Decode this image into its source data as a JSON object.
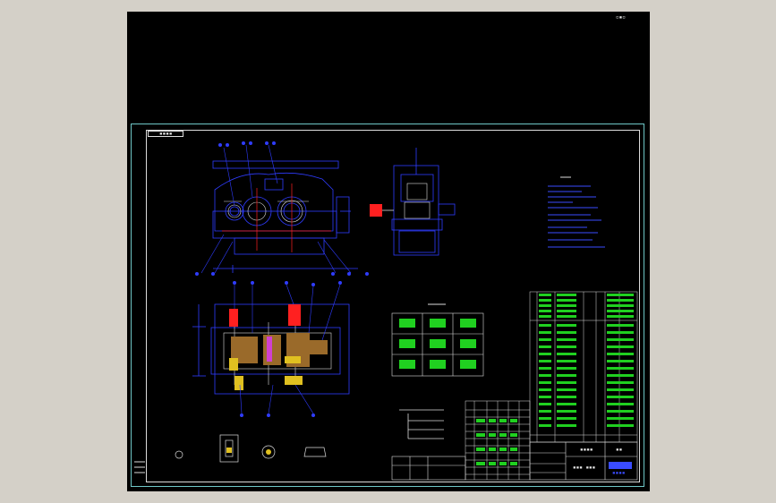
{
  "viewer": {
    "corner_mark": "▫▪▫",
    "sheet_tab": "▪▪▪▪"
  },
  "colors": {
    "background": "#000000",
    "frame_outer": "#6fc7c7",
    "frame_inner": "#dcdcdc",
    "drawing_blue": "#2f3cff",
    "callout_red": "#ff2020",
    "note_blue": "#3a4cff",
    "table_green": "#20d020",
    "table_grid": "#e0e0e0",
    "part_brown": "#9a6a2a",
    "part_yellow": "#e0c020",
    "part_magenta": "#d040d0"
  },
  "title_block": {
    "label_1": "▪▪▪▪",
    "label_2": "▪▪▪ ▪▪▪",
    "label_3": "▪▪",
    "stamp": "▪▪▪▪"
  }
}
